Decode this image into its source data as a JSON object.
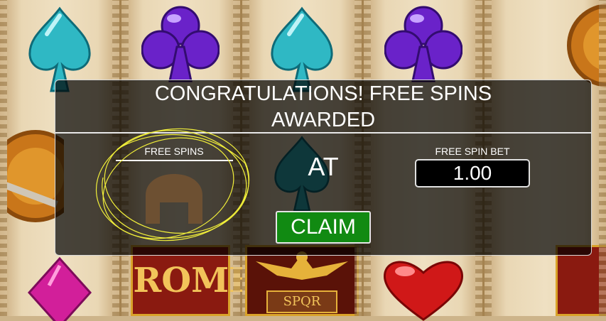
{
  "dialog": {
    "title_line1": "CONGRATULATIONS! FREE SPINS",
    "title_line2": "AWARDED",
    "free_spins_label": "FREE SPINS",
    "free_spins_value": "AT",
    "bet_label": "FREE SPIN BET",
    "bet_value": "1.00",
    "claim_label": "CLAIM"
  },
  "reels": {
    "rome_text": "ROME",
    "spqr_text": "SPQR"
  },
  "colors": {
    "spade": "#2fb8c4",
    "club": "#6a22c9",
    "heart": "#d01818",
    "diamond": "#d21f9a",
    "claim_button": "#118a12",
    "gold": "#c98a1a"
  }
}
